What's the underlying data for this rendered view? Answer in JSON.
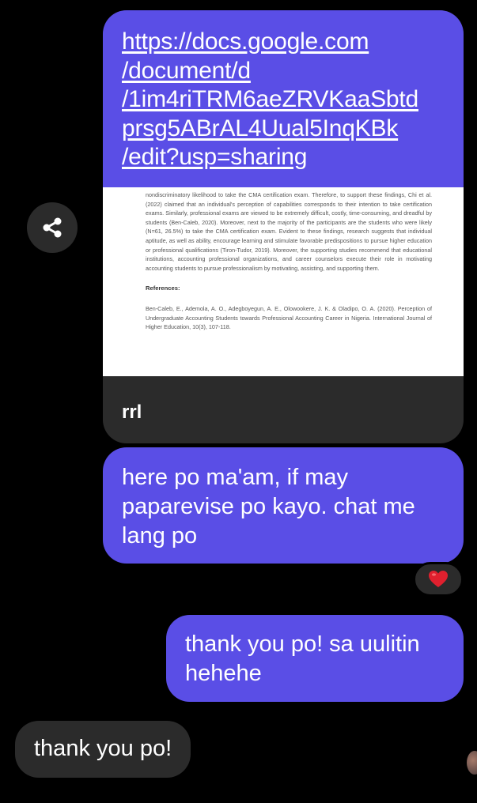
{
  "link_message": {
    "url_lines": [
      "https://docs.google.com",
      "/document/d",
      "/1im4riTRM6aeZRVKaaSbtd",
      "prsg5ABrAL4Uual5InqKBk",
      "/edit?usp=sharing"
    ],
    "preview_paragraph": "nondiscriminatory likelihood to take the CMA certification exam. Therefore, to support these findings, Chi et al. (2022) claimed that an individual's perception of capabilities corresponds to their intention to take certification exams. Similarly, professional exams are viewed to be extremely difficult, costly, time-consuming, and dreadful by students (Ben-Caleb, 2020). Moreover, next to the majority of the participants are the students who were likely (N=61, 26.5%) to take the CMA certification exam. Evident to these findings, research suggests that individual aptitude, as well as ability, encourage learning and stimulate favorable predispositions to pursue higher education or professional qualifications (Tiron-Tudor, 2019). Moreover, the supporting studies recommend that educational institutions, accounting professional organizations, and career counselors execute their role in motivating accounting students to pursue professionalism by motivating, assisting, and supporting them.",
    "preview_heading": "References:",
    "preview_reference": "Ben-Caleb, E., Ademola, A. O., Adegboyegun, A. E., Olowookere, J. K. & Oladipo, O. A. (2020). Perception of Undergraduate Accounting Students towards Professional Accounting Career in Nigeria. International Journal of Higher Education, 10(3), 107-118.",
    "title": "rrl"
  },
  "messages": {
    "sent_1": "here po ma'am, if may paparevise po kayo. chat me lang po",
    "sent_2": "thank you po! sa uulitin hehehe",
    "received_1": "thank you po!"
  },
  "reaction": {
    "icon": "heart-icon",
    "color": "#e0202e"
  },
  "icons": {
    "share": "share-icon"
  },
  "colors": {
    "sent_bubble": "#5a4ee6",
    "received_bubble": "#2b2b2b",
    "background": "#000000"
  }
}
